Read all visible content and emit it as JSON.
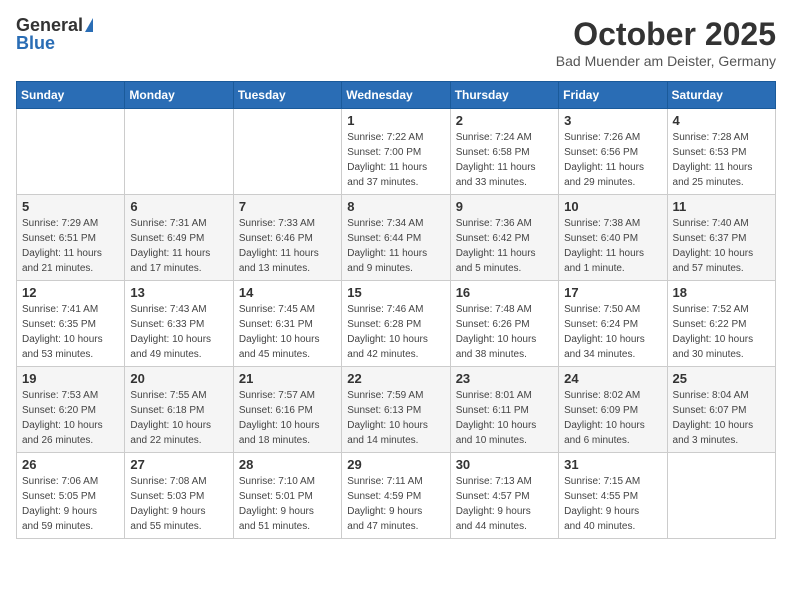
{
  "header": {
    "logo_general": "General",
    "logo_blue": "Blue",
    "title": "October 2025",
    "location": "Bad Muender am Deister, Germany"
  },
  "weekdays": [
    "Sunday",
    "Monday",
    "Tuesday",
    "Wednesday",
    "Thursday",
    "Friday",
    "Saturday"
  ],
  "weeks": [
    [
      {
        "day": "",
        "info": ""
      },
      {
        "day": "",
        "info": ""
      },
      {
        "day": "",
        "info": ""
      },
      {
        "day": "1",
        "info": "Sunrise: 7:22 AM\nSunset: 7:00 PM\nDaylight: 11 hours\nand 37 minutes."
      },
      {
        "day": "2",
        "info": "Sunrise: 7:24 AM\nSunset: 6:58 PM\nDaylight: 11 hours\nand 33 minutes."
      },
      {
        "day": "3",
        "info": "Sunrise: 7:26 AM\nSunset: 6:56 PM\nDaylight: 11 hours\nand 29 minutes."
      },
      {
        "day": "4",
        "info": "Sunrise: 7:28 AM\nSunset: 6:53 PM\nDaylight: 11 hours\nand 25 minutes."
      }
    ],
    [
      {
        "day": "5",
        "info": "Sunrise: 7:29 AM\nSunset: 6:51 PM\nDaylight: 11 hours\nand 21 minutes."
      },
      {
        "day": "6",
        "info": "Sunrise: 7:31 AM\nSunset: 6:49 PM\nDaylight: 11 hours\nand 17 minutes."
      },
      {
        "day": "7",
        "info": "Sunrise: 7:33 AM\nSunset: 6:46 PM\nDaylight: 11 hours\nand 13 minutes."
      },
      {
        "day": "8",
        "info": "Sunrise: 7:34 AM\nSunset: 6:44 PM\nDaylight: 11 hours\nand 9 minutes."
      },
      {
        "day": "9",
        "info": "Sunrise: 7:36 AM\nSunset: 6:42 PM\nDaylight: 11 hours\nand 5 minutes."
      },
      {
        "day": "10",
        "info": "Sunrise: 7:38 AM\nSunset: 6:40 PM\nDaylight: 11 hours\nand 1 minute."
      },
      {
        "day": "11",
        "info": "Sunrise: 7:40 AM\nSunset: 6:37 PM\nDaylight: 10 hours\nand 57 minutes."
      }
    ],
    [
      {
        "day": "12",
        "info": "Sunrise: 7:41 AM\nSunset: 6:35 PM\nDaylight: 10 hours\nand 53 minutes."
      },
      {
        "day": "13",
        "info": "Sunrise: 7:43 AM\nSunset: 6:33 PM\nDaylight: 10 hours\nand 49 minutes."
      },
      {
        "day": "14",
        "info": "Sunrise: 7:45 AM\nSunset: 6:31 PM\nDaylight: 10 hours\nand 45 minutes."
      },
      {
        "day": "15",
        "info": "Sunrise: 7:46 AM\nSunset: 6:28 PM\nDaylight: 10 hours\nand 42 minutes."
      },
      {
        "day": "16",
        "info": "Sunrise: 7:48 AM\nSunset: 6:26 PM\nDaylight: 10 hours\nand 38 minutes."
      },
      {
        "day": "17",
        "info": "Sunrise: 7:50 AM\nSunset: 6:24 PM\nDaylight: 10 hours\nand 34 minutes."
      },
      {
        "day": "18",
        "info": "Sunrise: 7:52 AM\nSunset: 6:22 PM\nDaylight: 10 hours\nand 30 minutes."
      }
    ],
    [
      {
        "day": "19",
        "info": "Sunrise: 7:53 AM\nSunset: 6:20 PM\nDaylight: 10 hours\nand 26 minutes."
      },
      {
        "day": "20",
        "info": "Sunrise: 7:55 AM\nSunset: 6:18 PM\nDaylight: 10 hours\nand 22 minutes."
      },
      {
        "day": "21",
        "info": "Sunrise: 7:57 AM\nSunset: 6:16 PM\nDaylight: 10 hours\nand 18 minutes."
      },
      {
        "day": "22",
        "info": "Sunrise: 7:59 AM\nSunset: 6:13 PM\nDaylight: 10 hours\nand 14 minutes."
      },
      {
        "day": "23",
        "info": "Sunrise: 8:01 AM\nSunset: 6:11 PM\nDaylight: 10 hours\nand 10 minutes."
      },
      {
        "day": "24",
        "info": "Sunrise: 8:02 AM\nSunset: 6:09 PM\nDaylight: 10 hours\nand 6 minutes."
      },
      {
        "day": "25",
        "info": "Sunrise: 8:04 AM\nSunset: 6:07 PM\nDaylight: 10 hours\nand 3 minutes."
      }
    ],
    [
      {
        "day": "26",
        "info": "Sunrise: 7:06 AM\nSunset: 5:05 PM\nDaylight: 9 hours\nand 59 minutes."
      },
      {
        "day": "27",
        "info": "Sunrise: 7:08 AM\nSunset: 5:03 PM\nDaylight: 9 hours\nand 55 minutes."
      },
      {
        "day": "28",
        "info": "Sunrise: 7:10 AM\nSunset: 5:01 PM\nDaylight: 9 hours\nand 51 minutes."
      },
      {
        "day": "29",
        "info": "Sunrise: 7:11 AM\nSunset: 4:59 PM\nDaylight: 9 hours\nand 47 minutes."
      },
      {
        "day": "30",
        "info": "Sunrise: 7:13 AM\nSunset: 4:57 PM\nDaylight: 9 hours\nand 44 minutes."
      },
      {
        "day": "31",
        "info": "Sunrise: 7:15 AM\nSunset: 4:55 PM\nDaylight: 9 hours\nand 40 minutes."
      },
      {
        "day": "",
        "info": ""
      }
    ]
  ]
}
